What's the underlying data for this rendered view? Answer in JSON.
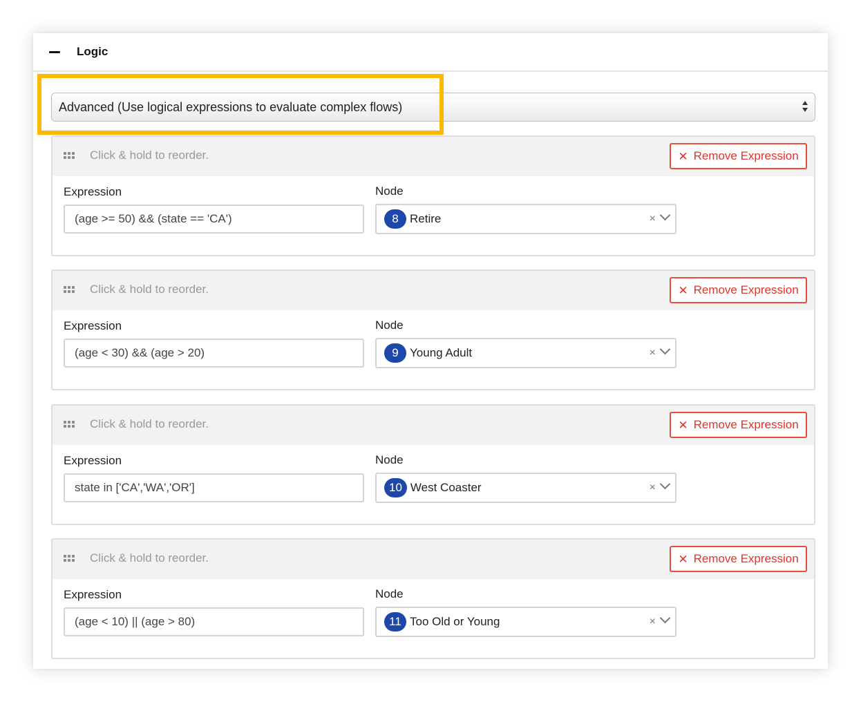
{
  "panel": {
    "title": "Logic",
    "collapse_icon": "minus-icon"
  },
  "mode_select": {
    "value": "Advanced (Use logical expressions to evaluate complex flows)",
    "highlight_color": "#fbb900"
  },
  "labels": {
    "reorder_hint": "Click & hold to reorder.",
    "remove_button": "Remove Expression",
    "expression": "Expression",
    "node": "Node",
    "clear_glyph": "×",
    "remove_glyph": "✕"
  },
  "expressions": [
    {
      "expression": "(age >= 50) && (state == 'CA')",
      "node_id": "8",
      "node_name": "Retire"
    },
    {
      "expression": "(age < 30) && (age > 20)",
      "node_id": "9",
      "node_name": "Young Adult"
    },
    {
      "expression": "state in ['CA','WA','OR']",
      "node_id": "10",
      "node_name": "West Coaster"
    },
    {
      "expression": "(age < 10) || (age > 80)",
      "node_id": "11",
      "node_name": "Too Old or Young"
    }
  ],
  "colors": {
    "remove_red": "#e2332a",
    "node_badge_blue": "#1d47a8"
  }
}
